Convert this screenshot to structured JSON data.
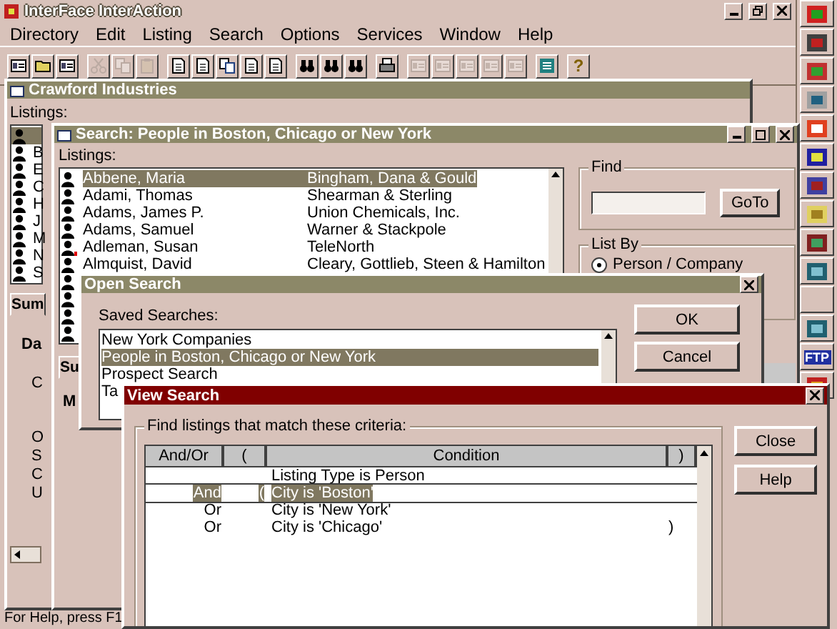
{
  "app": {
    "title": "InterFace InterAction",
    "menu": [
      "Directory",
      "Edit",
      "Listing",
      "Search",
      "Options",
      "Services",
      "Window",
      "Help"
    ],
    "toolbar": [
      [
        {
          "kind": "card",
          "disabled": false
        },
        {
          "kind": "folder",
          "disabled": false
        },
        {
          "kind": "card",
          "disabled": false
        }
      ],
      [
        {
          "kind": "cut",
          "disabled": true
        },
        {
          "kind": "copy",
          "disabled": true
        },
        {
          "kind": "paste",
          "disabled": true
        }
      ],
      [
        {
          "kind": "doc",
          "disabled": false
        },
        {
          "kind": "doc",
          "disabled": false
        },
        {
          "kind": "copy",
          "disabled": false
        },
        {
          "kind": "doc",
          "disabled": false
        },
        {
          "kind": "doc",
          "disabled": false
        }
      ],
      [
        {
          "kind": "find",
          "disabled": false
        },
        {
          "kind": "find",
          "disabled": false
        },
        {
          "kind": "find",
          "disabled": false
        }
      ],
      [
        {
          "kind": "print",
          "disabled": false
        }
      ],
      [
        {
          "kind": "card",
          "disabled": true
        },
        {
          "kind": "card",
          "disabled": true
        },
        {
          "kind": "card",
          "disabled": true
        },
        {
          "kind": "card",
          "disabled": true
        },
        {
          "kind": "card",
          "disabled": true
        }
      ],
      [
        {
          "kind": "list",
          "disabled": false
        }
      ],
      [
        {
          "kind": "help",
          "label": "?",
          "disabled": false
        }
      ]
    ],
    "status": "For Help, press F1"
  },
  "launcher": [
    {
      "kind": "flag"
    },
    {
      "kind": "bike"
    },
    {
      "kind": "blocks"
    },
    {
      "kind": "computer"
    },
    {
      "kind": "pdf"
    },
    {
      "kind": "printer"
    },
    {
      "kind": "castle"
    },
    {
      "kind": "folder"
    },
    {
      "kind": "frame"
    },
    {
      "kind": "network"
    },
    {
      "kind": "blank"
    },
    {
      "kind": "network"
    },
    {
      "kind": "text",
      "label": "FTP"
    },
    {
      "kind": "shoe"
    }
  ],
  "crawford": {
    "title": "Crawford Industries",
    "listings_label": "Listings:",
    "rows": [
      {
        "selected": true
      },
      {
        "text": "B",
        "selected": false
      },
      {
        "text": "E",
        "selected": false
      },
      {
        "text": "C",
        "selected": false
      },
      {
        "text": "H",
        "selected": false
      },
      {
        "text": "J",
        "selected": false
      },
      {
        "text": "M",
        "selected": false
      },
      {
        "text": "N",
        "selected": false
      },
      {
        "text": "S",
        "selected": false
      }
    ],
    "tab": "Sum",
    "fragments": [
      "Da",
      "C",
      "O",
      "S",
      "C",
      "U"
    ]
  },
  "search": {
    "title": "Search: People in Boston, Chicago or New York",
    "listings_label": "Listings:",
    "rows": [
      {
        "name": "Abbene, Maria",
        "company": "Bingham, Dana & Gould",
        "selected": true,
        "flagged": false
      },
      {
        "name": "Adami, Thomas",
        "company": "Shearman & Sterling",
        "selected": false,
        "flagged": false
      },
      {
        "name": "Adams, James P.",
        "company": "Union Chemicals, Inc.",
        "selected": false,
        "flagged": false
      },
      {
        "name": "Adams, Samuel",
        "company": "Warner & Stackpole",
        "selected": false,
        "flagged": false
      },
      {
        "name": "Adleman, Susan",
        "company": "TeleNorth",
        "selected": false,
        "flagged": true
      },
      {
        "name": "Almquist, David",
        "company": "Cleary, Gottlieb, Steen & Hamilton",
        "selected": false,
        "flagged": false
      },
      {
        "selected": false,
        "flagged": false
      },
      {
        "selected": false,
        "flagged": false
      },
      {
        "selected": false,
        "flagged": false
      },
      {
        "selected": false,
        "flagged": false
      }
    ],
    "find_label": "Find",
    "goto": "GoTo",
    "list_by": {
      "label": "List By",
      "option": "Person / Company",
      "selected": true
    },
    "tab": "Su",
    "fragment": "M"
  },
  "open_search": {
    "title": "Open Search",
    "label": "Saved Searches:",
    "items": [
      {
        "text": "New York Companies",
        "selected": false
      },
      {
        "text": "People in Boston, Chicago or New York",
        "selected": true
      },
      {
        "text": "Prospect Search",
        "selected": false
      },
      {
        "text": "Ta",
        "selected": false
      }
    ],
    "buttons": [
      "OK",
      "Cancel"
    ]
  },
  "view_search": {
    "title": "View Search",
    "group_label": "Find listings that match these criteria:",
    "columns": [
      "And/Or",
      "(",
      "Condition",
      ")"
    ],
    "rows": [
      {
        "condition": "Listing Type is Person",
        "selected": false
      },
      {
        "and_or": "And",
        "open": "(",
        "condition": "City is 'Boston'",
        "selected": true
      },
      {
        "and_or": "Or",
        "condition": "City is 'New York'",
        "selected": false
      },
      {
        "and_or": "Or",
        "condition": "City is 'Chicago'",
        "close": ")",
        "selected": false
      }
    ],
    "buttons": [
      "Close",
      "Help"
    ]
  }
}
